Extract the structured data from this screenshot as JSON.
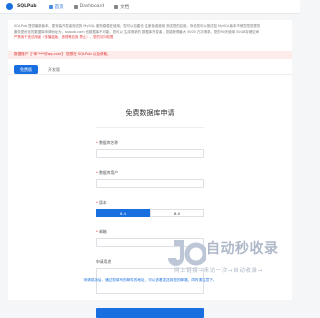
{
  "header": {
    "brand": "SQLPub",
    "nav": [
      {
        "label": "首页"
      },
      {
        "label": "Dashboard"
      },
      {
        "label": "文档"
      }
    ]
  },
  "intro": {
    "line1": "SQLPub 提供最新版本、更安装开发者测试的 MySQL 服务稳稳在使用，您可以自建也 注册免费使用 测试您的应用。你也您可以测试如 MySQL版本不难您您您提供",
    "line2": "服务是优化的数据库申请地址为，sqlpub.com 也数据库不可能，您可以 生成请求的 数据库开发者，您能获得最大 5000 万次请求。您的90天使用 50GB存储空间",
    "line3": "严禁用于违法用途（传播盗版、违规等应用 禁止），您的访问权限"
  },
  "alert": {
    "text": "数据账户【\"申\"***@qq.com】 您想在 SQLPub 以及获取。"
  },
  "tabs": [
    {
      "label": "免费版"
    },
    {
      "label": "开发版"
    }
  ],
  "form": {
    "title": "免费数据库申请",
    "fields": {
      "db_name": "数据库名称",
      "db_user": "数据库用户",
      "version": "版本",
      "email": "邮箱",
      "reason": "申请用途"
    },
    "versions": [
      "8.4",
      "8.0"
    ]
  },
  "footer": {
    "note": "申请成功后，通过您填写的邮件的地址，可以查看发送到您的邮箱，同时请注意下。"
  },
  "watermark": {
    "title": "自动秒收录",
    "subtitle": "网上链接→来访一次→自动收录→"
  }
}
